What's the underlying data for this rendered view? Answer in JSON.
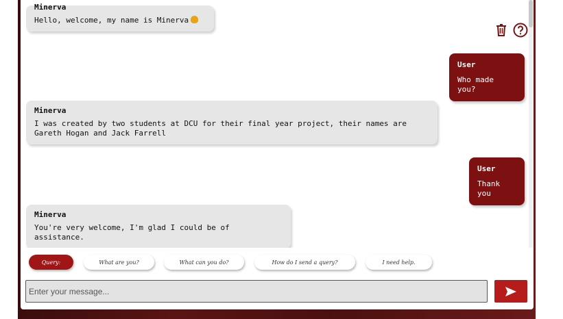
{
  "colors": {
    "accent": "#7d1010",
    "query_chip": "#a01515",
    "send_button": "#b71c1c",
    "bot_bubble": "#e6e6e6"
  },
  "header": {
    "delete_icon": "trash-icon",
    "help_icon": "help-circle-icon"
  },
  "messages": [
    {
      "role": "bot",
      "sender": "Minerva",
      "text": "Hello, welcome, my name is Minerva"
    },
    {
      "role": "user",
      "sender": "User",
      "text": "Who made you?"
    },
    {
      "role": "bot",
      "sender": "Minerva",
      "text": "I was created by two students at DCU for their final year project, their names are Gareth Hogan and Jack Farrell"
    },
    {
      "role": "user",
      "sender": "User",
      "text": "Thank you"
    },
    {
      "role": "bot",
      "sender": "Minerva",
      "text": "You're very welcome, I'm glad I could be of assistance."
    }
  ],
  "suggestions": {
    "query_label": "Query:",
    "items": [
      "What are you?",
      "What can you do?",
      "How do I send a query?",
      "I need help."
    ]
  },
  "input": {
    "placeholder": "Enter your message...",
    "value": ""
  },
  "send": {
    "icon": "send-icon"
  }
}
